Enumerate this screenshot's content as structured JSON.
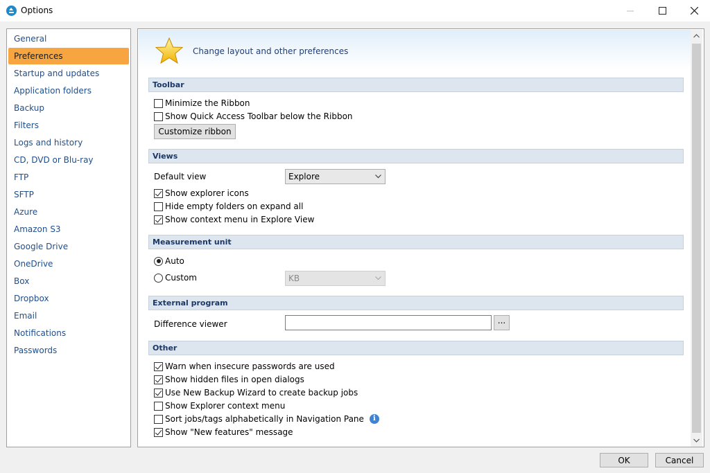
{
  "window": {
    "title": "Options"
  },
  "nav": {
    "items": [
      {
        "label": "General"
      },
      {
        "label": "Preferences",
        "selected": true
      },
      {
        "label": "Startup and updates"
      },
      {
        "label": "Application folders"
      },
      {
        "label": "Backup"
      },
      {
        "label": "Filters"
      },
      {
        "label": "Logs and history"
      },
      {
        "label": "CD, DVD or Blu-ray"
      },
      {
        "label": "FTP"
      },
      {
        "label": "SFTP"
      },
      {
        "label": "Azure"
      },
      {
        "label": "Amazon S3"
      },
      {
        "label": "Google Drive"
      },
      {
        "label": "OneDrive"
      },
      {
        "label": "Box"
      },
      {
        "label": "Dropbox"
      },
      {
        "label": "Email"
      },
      {
        "label": "Notifications"
      },
      {
        "label": "Passwords"
      }
    ]
  },
  "banner": {
    "text": "Change layout and other preferences",
    "icon": "star-icon"
  },
  "toolbar": {
    "heading": "Toolbar",
    "minimize_ribbon": {
      "label": "Minimize the Ribbon",
      "checked": false
    },
    "quick_access_below": {
      "label": "Show Quick Access Toolbar below the Ribbon",
      "checked": false
    },
    "customize_button": "Customize ribbon"
  },
  "views": {
    "heading": "Views",
    "default_view_label": "Default view",
    "default_view_value": "Explore",
    "show_explorer_icons": {
      "label": "Show explorer icons",
      "checked": true
    },
    "hide_empty_folders": {
      "label": "Hide empty folders on expand all",
      "checked": false
    },
    "show_context_menu": {
      "label": "Show context menu in Explore View",
      "checked": true
    }
  },
  "measurement": {
    "heading": "Measurement unit",
    "auto": {
      "label": "Auto",
      "selected": true
    },
    "custom": {
      "label": "Custom",
      "selected": false
    },
    "custom_unit_value": "KB"
  },
  "external": {
    "heading": "External program",
    "diff_viewer_label": "Difference viewer",
    "diff_viewer_value": "",
    "browse_button": "..."
  },
  "other": {
    "heading": "Other",
    "items": [
      {
        "label": "Warn when insecure passwords are used",
        "checked": true
      },
      {
        "label": "Show hidden files in open dialogs",
        "checked": true
      },
      {
        "label": "Use New Backup Wizard to create backup jobs",
        "checked": true
      },
      {
        "label": "Show Explorer context menu",
        "checked": false
      },
      {
        "label": "Sort jobs/tags alphabetically in Navigation Pane",
        "checked": false,
        "info": true
      },
      {
        "label": "Show \"New features\" message",
        "checked": true
      }
    ]
  },
  "footer": {
    "ok": "OK",
    "cancel": "Cancel"
  },
  "colors": {
    "selected_nav": "#f7a540",
    "link_text": "#1f4e8c",
    "section_bg": "#dde6ef"
  }
}
